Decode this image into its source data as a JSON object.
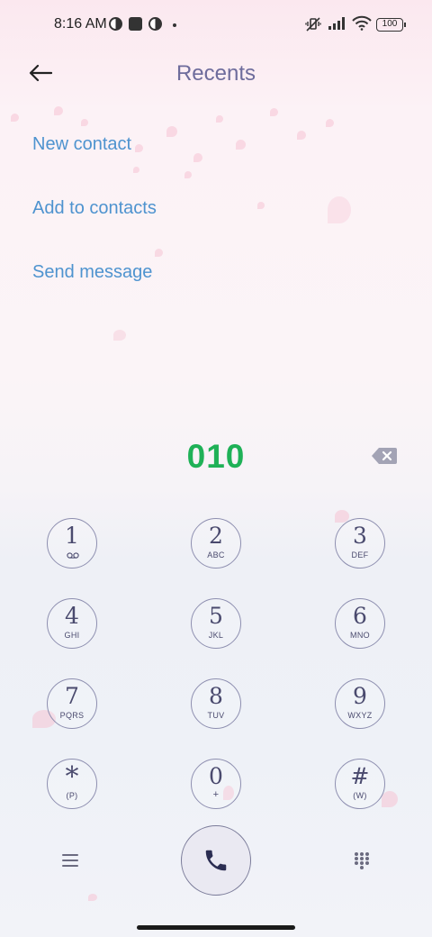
{
  "status_bar": {
    "time": "8:16 AM",
    "battery": "100"
  },
  "header": {
    "title": "Recents"
  },
  "actions": {
    "new_contact": "New contact",
    "add_to_contacts": "Add to contacts",
    "send_message": "Send message"
  },
  "dialer": {
    "number": "010"
  },
  "keypad": {
    "k1": {
      "digit": "1"
    },
    "k2": {
      "digit": "2",
      "letters": "ABC"
    },
    "k3": {
      "digit": "3",
      "letters": "DEF"
    },
    "k4": {
      "digit": "4",
      "letters": "GHI"
    },
    "k5": {
      "digit": "5",
      "letters": "JKL"
    },
    "k6": {
      "digit": "6",
      "letters": "MNO"
    },
    "k7": {
      "digit": "7",
      "letters": "PQRS"
    },
    "k8": {
      "digit": "8",
      "letters": "TUV"
    },
    "k9": {
      "digit": "9",
      "letters": "WXYZ"
    },
    "kstar": {
      "digit": "*",
      "letters": "(P)"
    },
    "k0": {
      "digit": "0",
      "letters": "+"
    },
    "khash": {
      "digit": "#",
      "letters": "(W)"
    }
  },
  "colors": {
    "number": "#1fb157",
    "links": "#4e93cf",
    "title": "#6e6c9c",
    "keys": "#4a4a6e"
  }
}
